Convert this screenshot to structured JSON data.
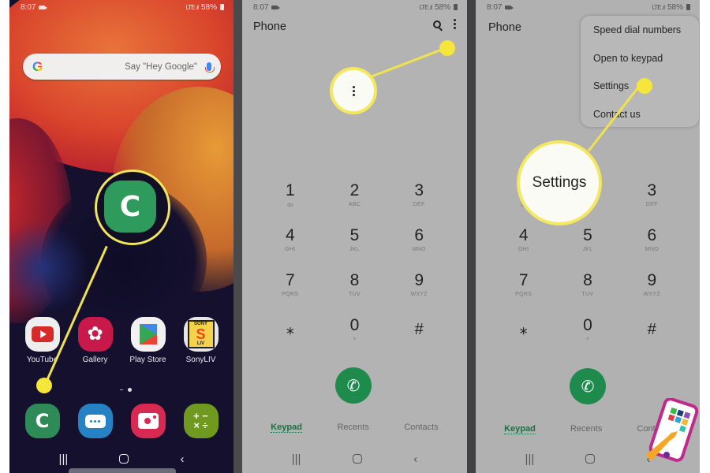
{
  "status_bar": {
    "time": "8:07",
    "signal_text": "LTE .ıl",
    "battery": "58%"
  },
  "home_screen": {
    "search_bar": {
      "logo": "G",
      "placeholder": "Say \"Hey Google\"",
      "mic_icon": "mic-icon"
    },
    "highlighted_app": {
      "name": "Phone",
      "icon": "phone-icon"
    },
    "apps": [
      {
        "label": "YouTube",
        "icon": "youtube-icon",
        "color": "#d62a2a"
      },
      {
        "label": "Gallery",
        "icon": "gallery-icon",
        "color": "#c8194a"
      },
      {
        "label": "Play Store",
        "icon": "play-store-icon",
        "color": "#f1f1f1"
      },
      {
        "label": "SonyLIV",
        "icon": "sonyliv-icon",
        "color": "#e8e8e8"
      }
    ],
    "dock": [
      {
        "name": "Phone",
        "icon": "phone-icon",
        "color": "#2e8b57"
      },
      {
        "name": "Messages",
        "icon": "messages-icon",
        "color": "#2582c4"
      },
      {
        "name": "Camera",
        "icon": "camera-icon",
        "color": "#d82952"
      },
      {
        "name": "Calculator",
        "icon": "calculator-icon",
        "color": "#6f9a1f"
      }
    ],
    "sony_text": "SONY",
    "sony_sub": "LIV"
  },
  "dialer": {
    "title": "Phone",
    "keys": [
      {
        "digit": "1",
        "letters": "ꝏ"
      },
      {
        "digit": "2",
        "letters": "ABC"
      },
      {
        "digit": "3",
        "letters": "DEF"
      },
      {
        "digit": "4",
        "letters": "GHI"
      },
      {
        "digit": "5",
        "letters": "JKL"
      },
      {
        "digit": "6",
        "letters": "MNO"
      },
      {
        "digit": "7",
        "letters": "PQRS"
      },
      {
        "digit": "8",
        "letters": "TUV"
      },
      {
        "digit": "9",
        "letters": "WXYZ"
      },
      {
        "digit": "⁎",
        "letters": ""
      },
      {
        "digit": "0",
        "letters": "+"
      },
      {
        "digit": "#",
        "letters": ""
      }
    ],
    "tabs": [
      {
        "label": "Keypad",
        "active": true
      },
      {
        "label": "Recents",
        "active": false
      },
      {
        "label": "Contacts",
        "active": false
      }
    ]
  },
  "overflow_menu": {
    "items": [
      {
        "label": "Speed dial numbers"
      },
      {
        "label": "Open to keypad"
      },
      {
        "label": "Settings"
      },
      {
        "label": "Contact us"
      }
    ]
  },
  "callouts": {
    "more_options_glyph": "⋮",
    "settings_label": "Settings"
  },
  "navbar": {
    "recents": "|||",
    "back": "‹"
  },
  "colors": {
    "callout_yellow": "#f3e860",
    "call_green": "#1e8b4d",
    "active_tab": "#1d6e42"
  }
}
